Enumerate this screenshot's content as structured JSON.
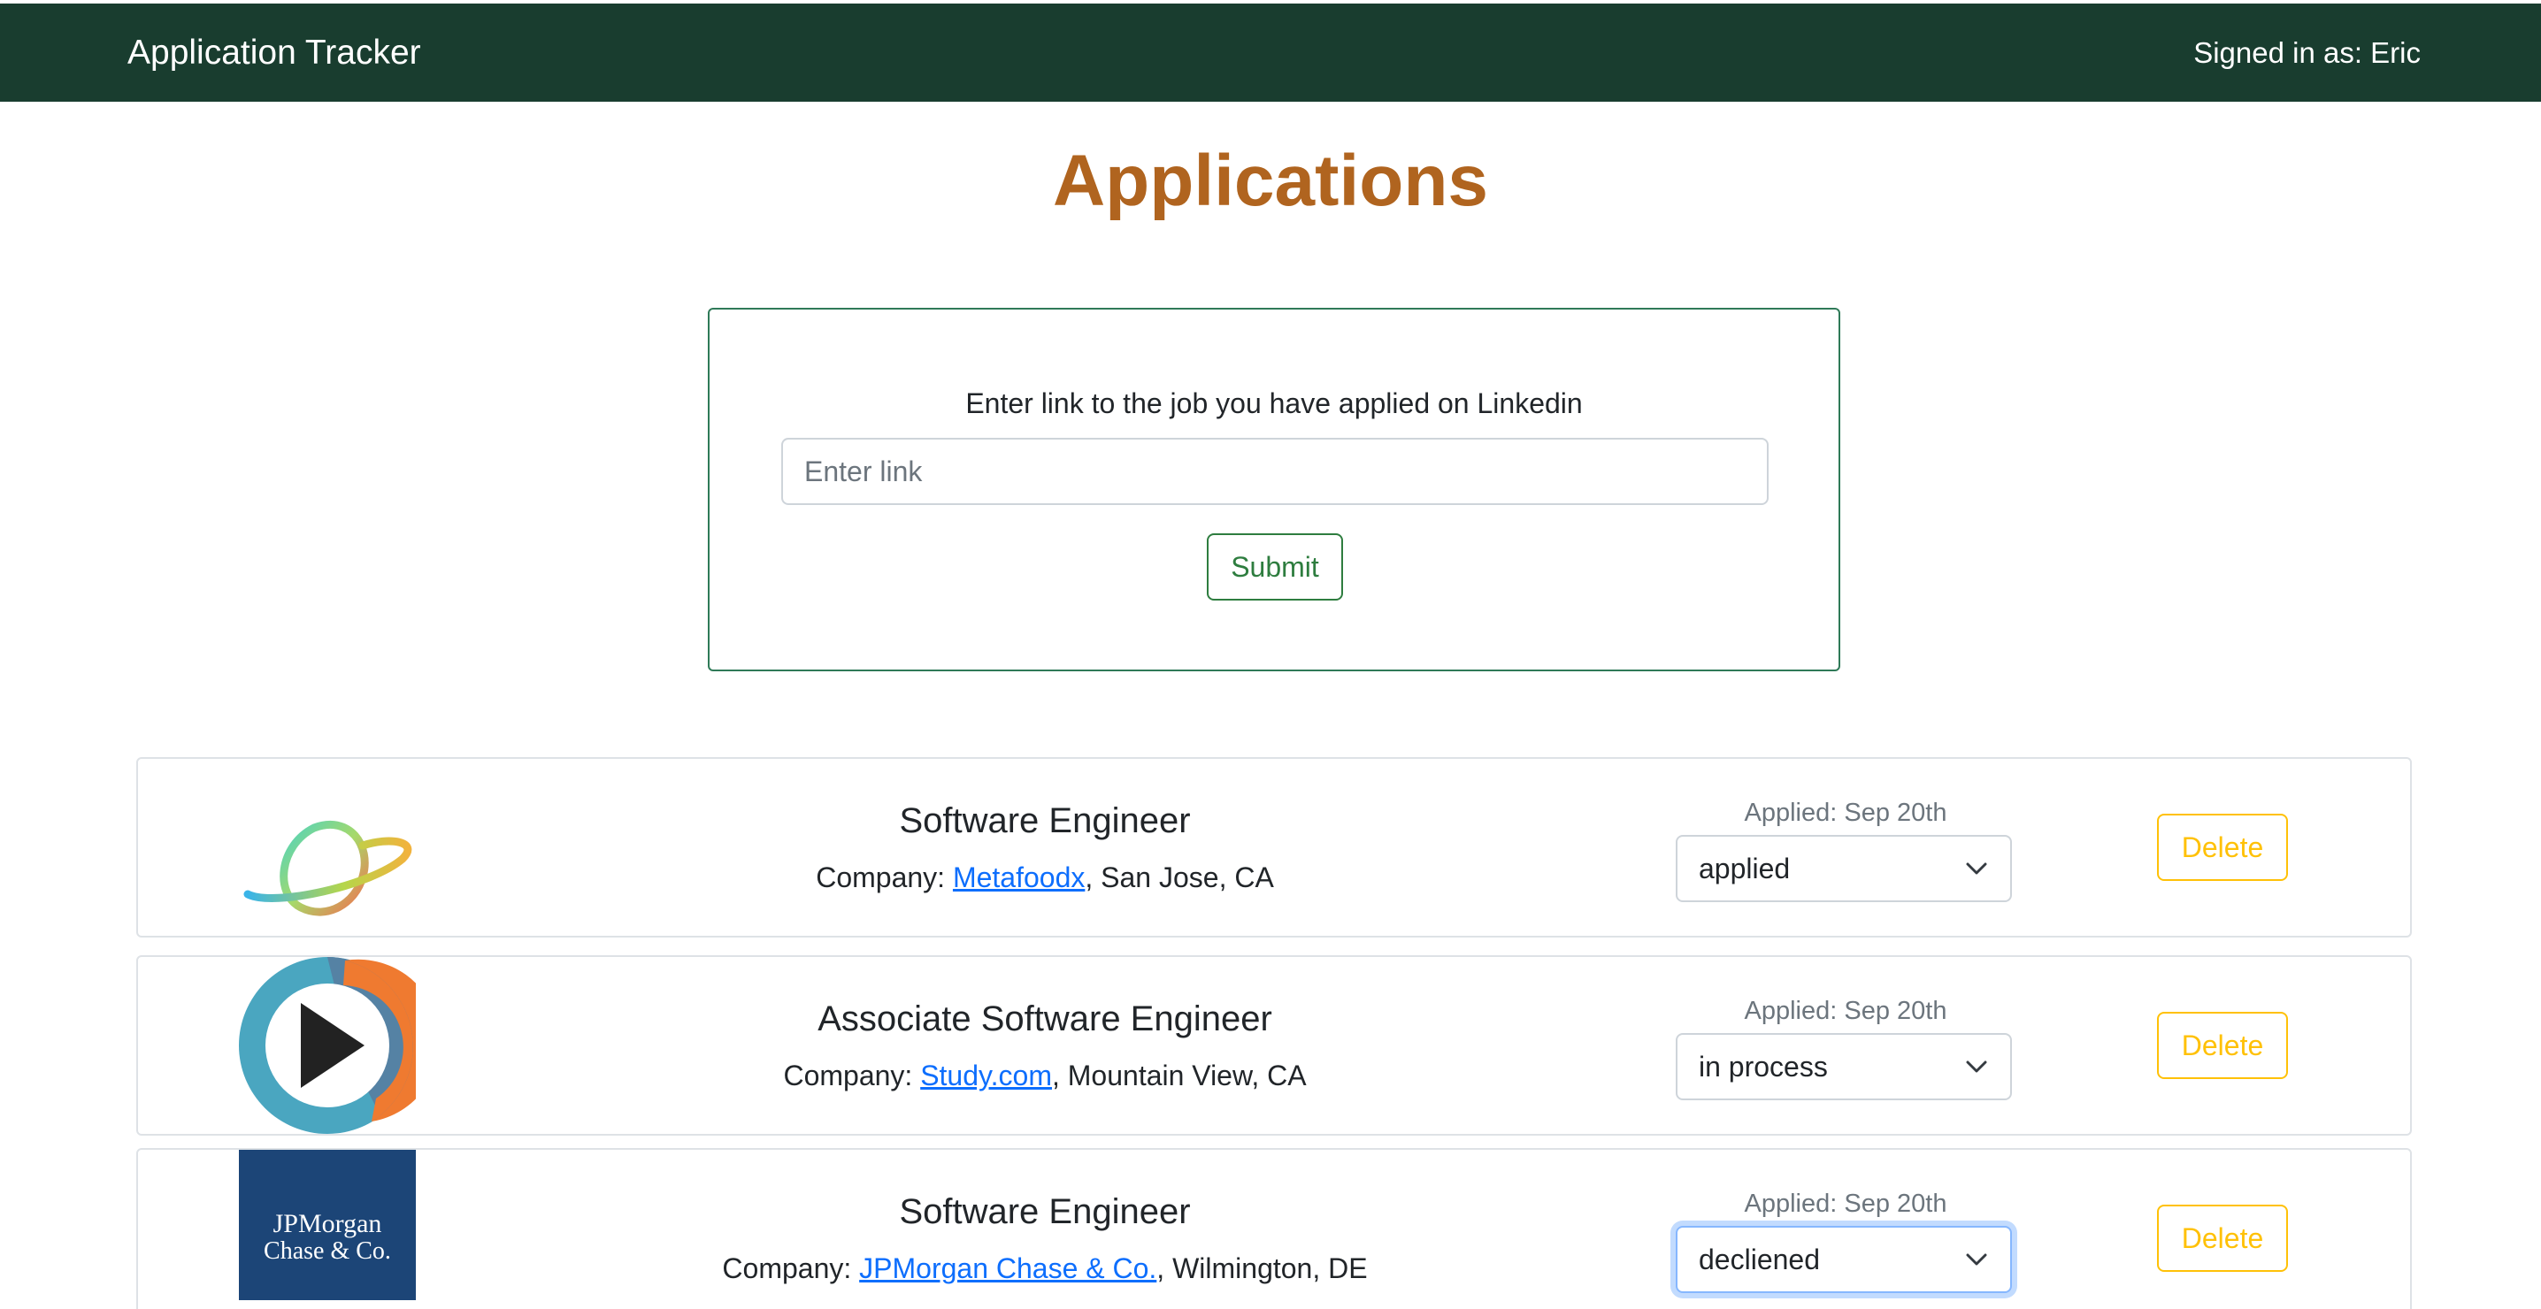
{
  "navbar": {
    "brand": "Application Tracker",
    "signed_in": "Signed in as: Eric"
  },
  "page_title": "Applications",
  "link_form": {
    "prompt": "Enter link to the job you have applied on Linkedin",
    "input_placeholder": "Enter link",
    "input_value": "",
    "submit_label": "Submit"
  },
  "applications": [
    {
      "logo": "metafoodx-planet-logo",
      "title": "Software Engineer",
      "company_prefix": "Company: ",
      "company": "Metafoodx",
      "location": ", San Jose, CA",
      "applied": "Applied: Sep 20th",
      "status": "applied",
      "delete_label": "Delete"
    },
    {
      "logo": "study-com-play-logo",
      "title": "Associate Software Engineer",
      "company_prefix": "Company: ",
      "company": "Study.com",
      "location": ", Mountain View, CA",
      "applied": "Applied: Sep 20th",
      "status": "in process",
      "delete_label": "Delete"
    },
    {
      "logo": "jpmorgan-chase-logo",
      "logo_text_line1": "JPMorgan",
      "logo_text_line2": "Chase & Co.",
      "title": "Software Engineer",
      "company_prefix": "Company: ",
      "company": "JPMorgan Chase & Co.",
      "location": ", Wilmington, DE",
      "applied": "Applied: Sep 20th",
      "status": "decliened",
      "delete_label": "Delete"
    }
  ],
  "colors": {
    "navbar_bg": "#193d2f",
    "title": "#b0641f",
    "form_border": "#2f7a58",
    "submit": "#2e7d3f",
    "link": "#0d6efd",
    "delete": "#ffc107",
    "jpmorgan_blue": "#1c4577"
  }
}
